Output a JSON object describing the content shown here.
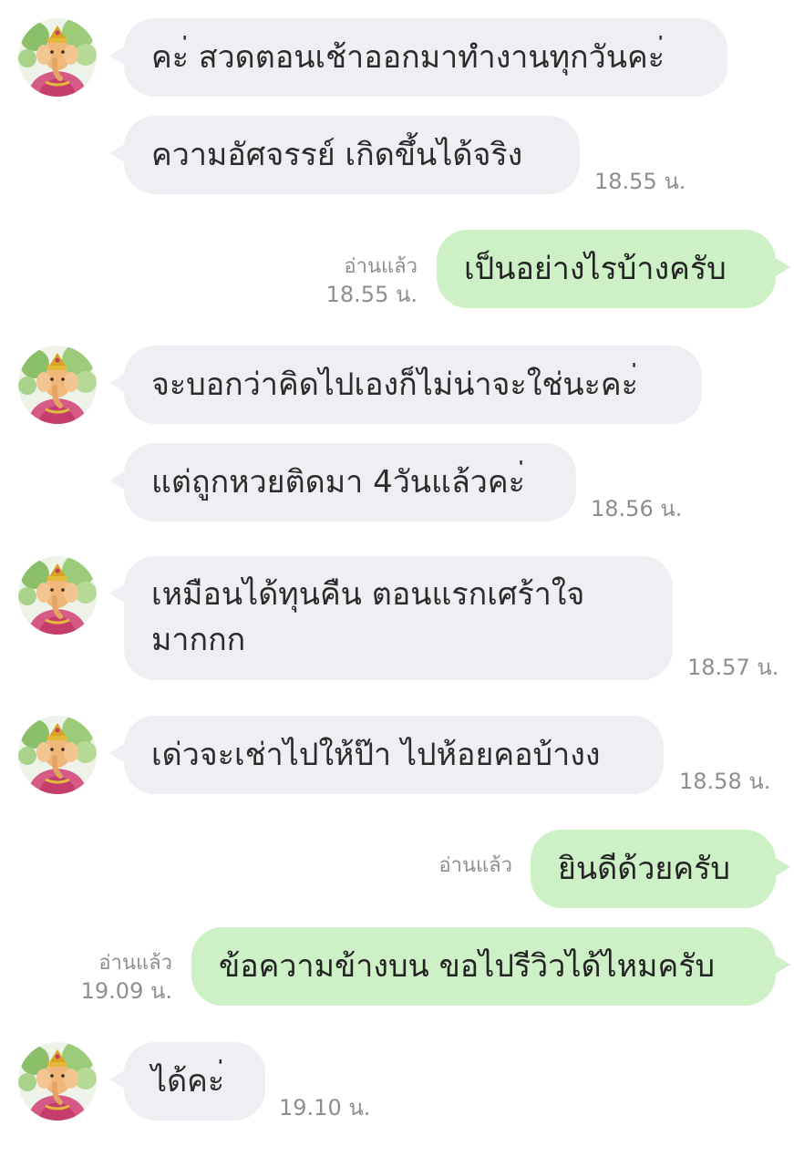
{
  "chat": {
    "messages": [
      {
        "side": "in",
        "text": "คะ่ สวดตอนเช้าออกมาทำงานทุกวันคะ่",
        "time": ""
      },
      {
        "side": "in",
        "text": "ความอัศจรรย์ เกิดขึ้นได้จริง",
        "time": "18.55 น."
      },
      {
        "side": "out",
        "text": "เป็นอย่างไรบ้างครับ",
        "read": "อ่านแล้ว",
        "time": "18.55 น."
      },
      {
        "side": "in",
        "text": "จะบอกว่าคิดไปเองก็ไม่น่าจะใช่นะคะ่",
        "time": ""
      },
      {
        "side": "in",
        "text": "แต่ถูกหวยติดมา 4วันแล้วคะ่",
        "time": "18.56 น."
      },
      {
        "side": "in",
        "text": "เหมือนได้ทุนคืน ตอนแรกเศร้าใจ มากกก",
        "time": "18.57 น."
      },
      {
        "side": "in",
        "text": "เด่วจะเช่าไปให้ป๊า ไปห้อยคอบ้างง",
        "time": "18.58 น."
      },
      {
        "side": "out",
        "text": "ยินดีด้วยครับ",
        "read": "อ่านแล้ว",
        "time": ""
      },
      {
        "side": "out",
        "text": "ข้อความข้างบน ขอไปรีวิวได้ไหมครับ",
        "read": "อ่านแล้ว",
        "time": "19.09 น."
      },
      {
        "side": "in",
        "text": "ได้คะ่",
        "time": "19.10 น."
      }
    ]
  },
  "colors": {
    "incoming_bubble": "#eeeff2",
    "outgoing_bubble": "#cdf0c6",
    "timestamp": "#8b8f93"
  },
  "icons": {
    "avatar": "ganesha-avatar-icon"
  }
}
